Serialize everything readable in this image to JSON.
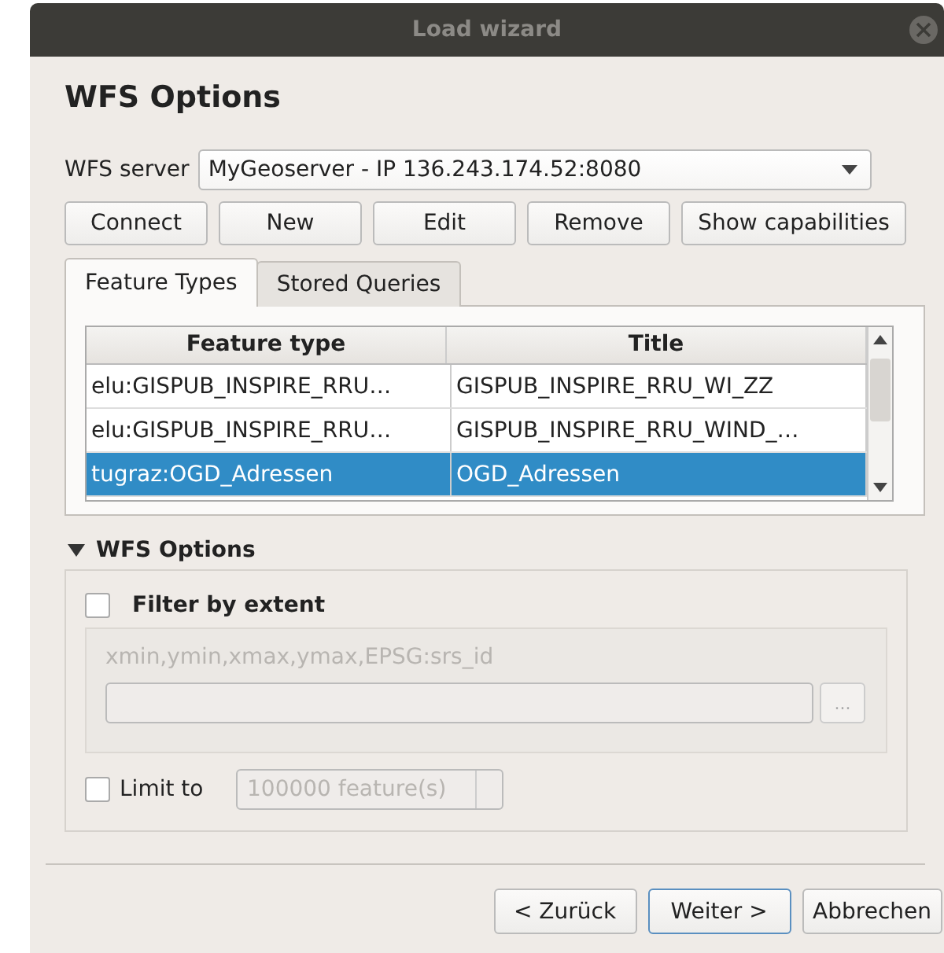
{
  "window": {
    "title": "Load wizard"
  },
  "heading": "WFS Options",
  "server": {
    "label": "WFS server",
    "value": "MyGeoserver - IP 136.243.174.52:8080"
  },
  "server_buttons": [
    "Connect",
    "New",
    "Edit",
    "Remove",
    "Show capabilities"
  ],
  "tabs": [
    {
      "label": "Feature Types",
      "selected": true
    },
    {
      "label": "Stored Queries",
      "selected": false
    }
  ],
  "table": {
    "columns": [
      "Feature type",
      "Title"
    ],
    "rows": [
      {
        "cells": [
          "elu:GISPUB_INSPIRE_RRU…",
          "GISPUB_INSPIRE_RRU_WI_ZZ"
        ],
        "selected": false
      },
      {
        "cells": [
          "elu:GISPUB_INSPIRE_RRU…",
          "GISPUB_INSPIRE_RRU_WIND_…"
        ],
        "selected": false
      },
      {
        "cells": [
          "tugraz:OGD_Adressen",
          "OGD_Adressen"
        ],
        "selected": true
      }
    ]
  },
  "options": {
    "title": "WFS Options",
    "expanded": true,
    "filter": {
      "label": "Filter by extent",
      "checked": false,
      "hint": "xmin,ymin,xmax,ymax,EPSG:srs_id",
      "button": "..."
    },
    "limit": {
      "label": "Limit to",
      "checked": false,
      "value": "100000 feature(s)"
    }
  },
  "buttons": [
    {
      "label": "< Zurück",
      "default": false
    },
    {
      "label": "Weiter >",
      "default": true
    },
    {
      "label": "Abbrechen",
      "default": false
    }
  ]
}
